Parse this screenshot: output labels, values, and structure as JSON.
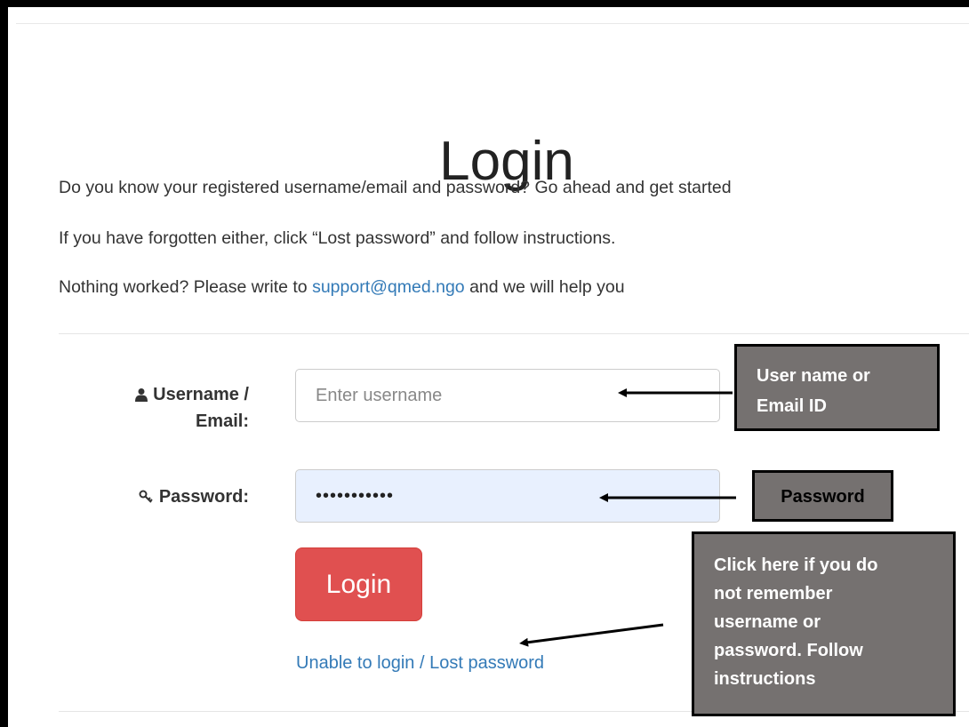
{
  "page": {
    "title": "Login",
    "intro_lines": [
      "Do you know your registered username/email and password? Go ahead and get started",
      "If you have forgotten either, click “Lost password” and follow instructions."
    ],
    "help_prefix": "Nothing worked? Please write to ",
    "support_email": "support@qmed.ngo",
    "help_suffix": " and we will help you"
  },
  "form": {
    "username_label_line1": "Username /",
    "username_label_line2": "Email:",
    "username_placeholder": "Enter username",
    "username_value": "",
    "password_label": "Password:",
    "password_value": "hiddenpass1",
    "login_button": "Login",
    "lost_password_link": "Unable to login / Lost password"
  },
  "annotations": {
    "username_callout": [
      "User name or",
      "Email ID"
    ],
    "password_callout": "Password",
    "lost_callout": [
      "Click here if you do",
      "not remember",
      "username or",
      "password. Follow",
      "instructions"
    ]
  },
  "colors": {
    "link": "#337ab7",
    "button": "#e05050",
    "callout_bg": "#757170",
    "password_field_bg": "#e8f0fe"
  },
  "icons": {
    "username": "user-icon",
    "password": "key-icon"
  }
}
